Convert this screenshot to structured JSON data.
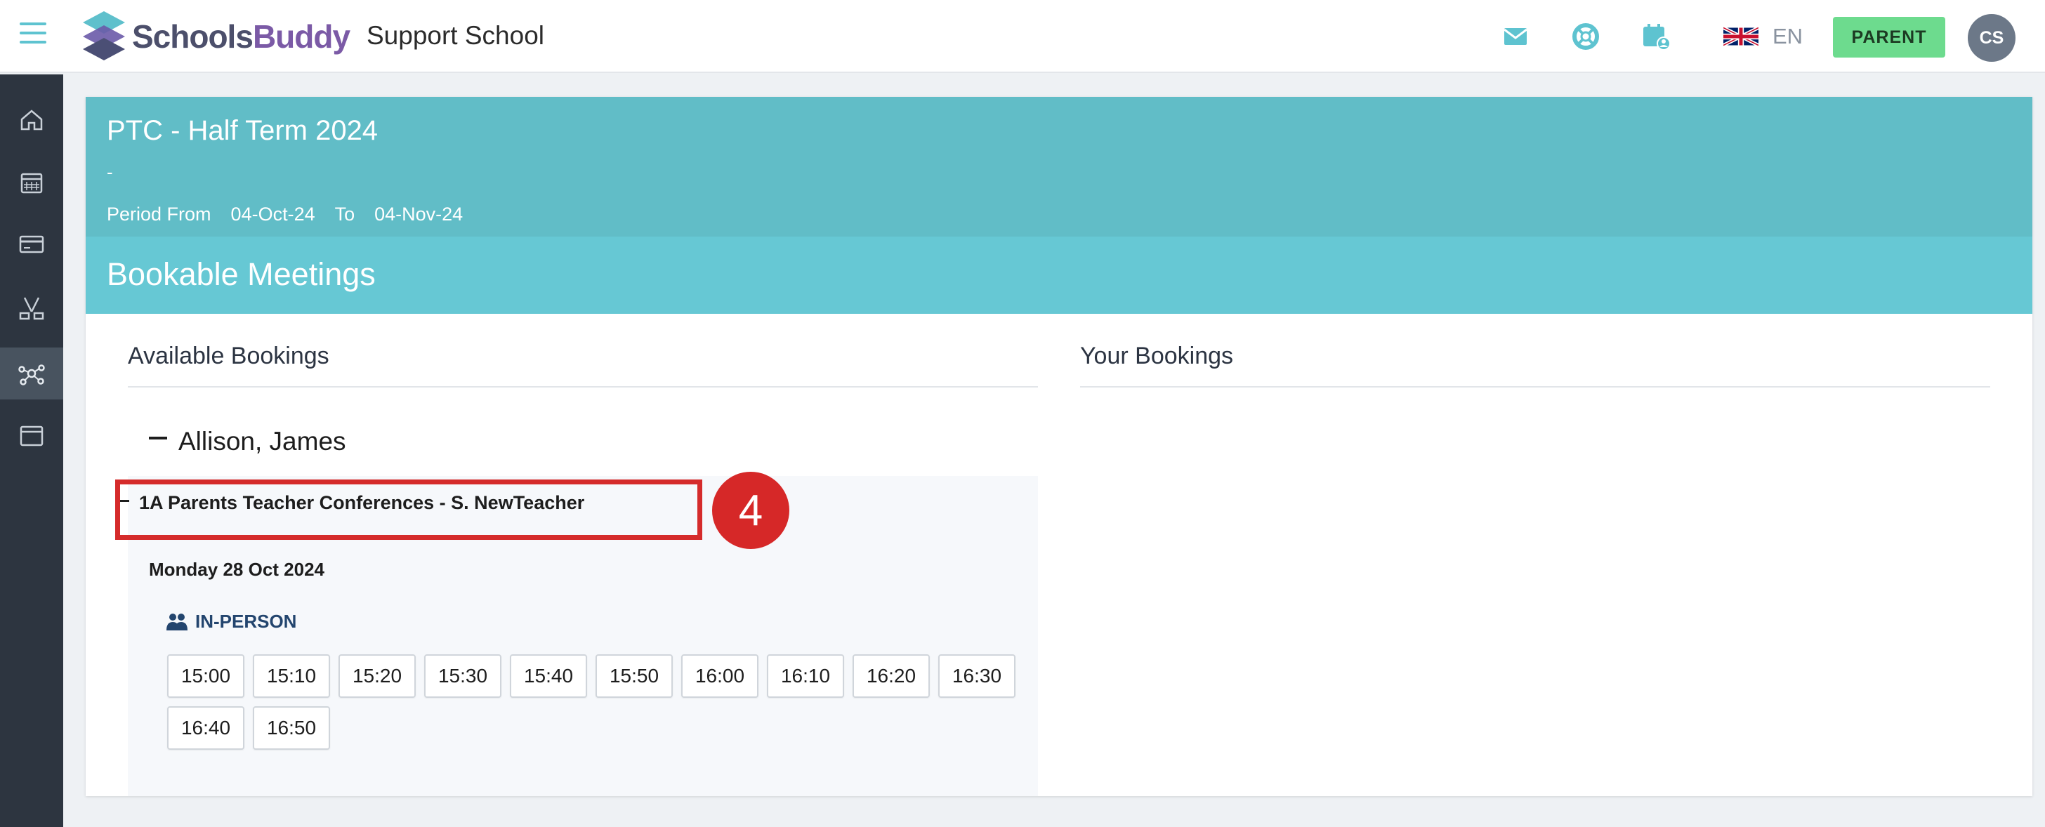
{
  "app": {
    "logo": {
      "part1": "Schools",
      "part2": "Buddy"
    },
    "school_name": "Support School"
  },
  "topbar": {
    "icons": [
      "envelope-icon",
      "lifebuoy-icon",
      "calendar-user-icon"
    ],
    "language": "EN",
    "role_button": "PARENT",
    "avatar_initials": "CS"
  },
  "sidebar": {
    "items": [
      "home-icon",
      "calendar-icon",
      "card-icon",
      "activities-icon",
      "network-icon",
      "window-icon"
    ],
    "active_index": 4
  },
  "event": {
    "title": "PTC - Half Term 2024",
    "description": "-",
    "period_from_label": "Period From",
    "period_from": "04-Oct-24",
    "to_label": "To",
    "period_to": "04-Nov-24"
  },
  "section": {
    "title": "Bookable Meetings",
    "available_heading": "Available Bookings",
    "your_heading": "Your Bookings"
  },
  "student": {
    "name": "Allison, James",
    "conference": "1A Parents Teacher Conferences - S. NewTeacher",
    "date": "Monday 28 Oct 2024",
    "mode": "IN-PERSON",
    "slots": [
      "15:00",
      "15:10",
      "15:20",
      "15:30",
      "15:40",
      "15:50",
      "16:00",
      "16:10",
      "16:20",
      "16:30",
      "16:40",
      "16:50"
    ]
  },
  "annotation": {
    "step_number": "4"
  },
  "colors": {
    "header_teal": "#61bdc7",
    "bookable_teal": "#66c8d4",
    "sidebar": "#2d3540",
    "parent_green": "#6ddb8e",
    "highlight_red": "#d52b2b"
  }
}
